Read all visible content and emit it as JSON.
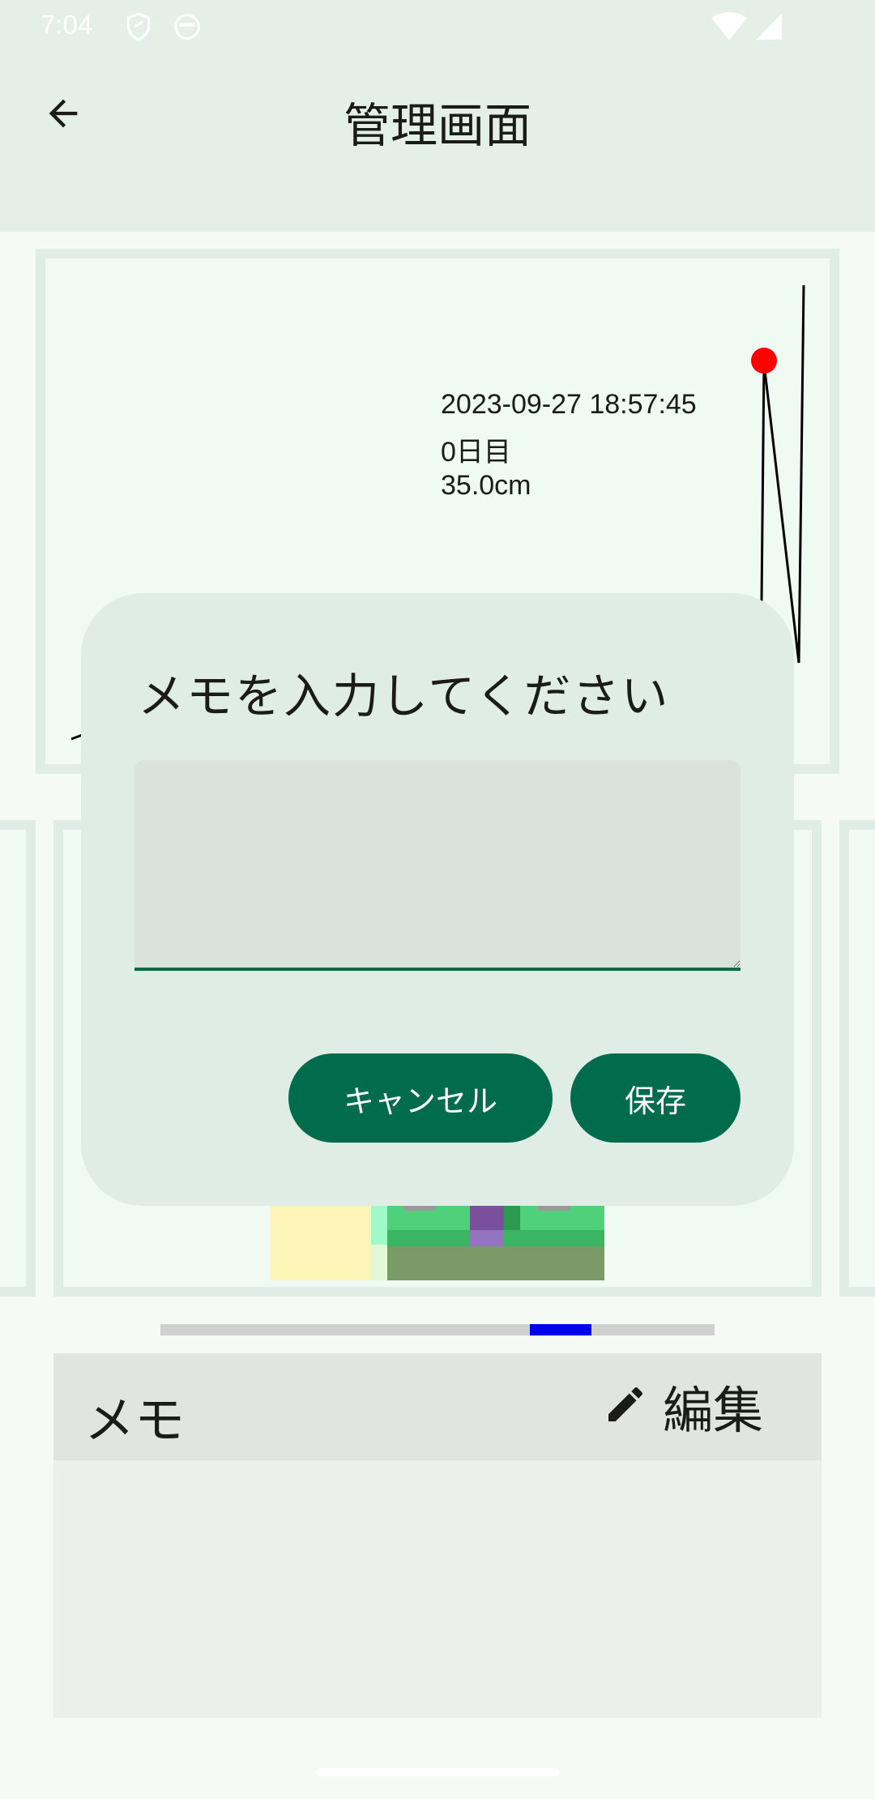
{
  "status_bar": {
    "time": "7:04",
    "icons": [
      "shield-icon",
      "android-face-icon",
      "wifi-icon",
      "cell-signal-icon"
    ]
  },
  "app_bar": {
    "title": "管理画面",
    "back_icon": "arrow-back-icon"
  },
  "chart": {
    "tooltip": {
      "datetime": "2023-09-27 18:57:45",
      "day": "0日目",
      "value": "35.0cm"
    },
    "marker_color": "#ff0000",
    "line_color": "#000000"
  },
  "pager": {
    "indicator_color": "#0000ee"
  },
  "memo": {
    "label": "メモ",
    "edit_label": "編集",
    "edit_icon": "pencil-icon",
    "content": ""
  },
  "dialog": {
    "title": "メモを入力してください",
    "input_value": "",
    "cancel_label": "キャンセル",
    "save_label": "保存"
  },
  "colors": {
    "primary": "#006c4c",
    "surface": "#e0ede6",
    "background": "#f6faf5"
  }
}
